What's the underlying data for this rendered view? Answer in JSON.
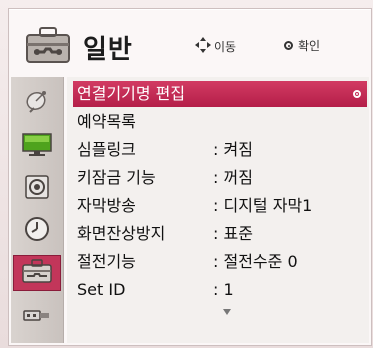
{
  "header": {
    "title": "일반",
    "icon": "toolbox-icon",
    "hint_move": "이동",
    "hint_ok": "확인"
  },
  "sidebar": {
    "items": [
      {
        "icon": "satellite-dish-icon",
        "active": false
      },
      {
        "icon": "monitor-icon",
        "active": false
      },
      {
        "icon": "speaker-icon",
        "active": false
      },
      {
        "icon": "clock-icon",
        "active": false
      },
      {
        "icon": "toolbox-icon",
        "active": true
      },
      {
        "icon": "usb-icon",
        "active": false
      }
    ]
  },
  "menu": {
    "items": [
      {
        "label": "연결기기명 편집",
        "value": "",
        "selected": true
      },
      {
        "label": "예약목록",
        "value": ""
      },
      {
        "label": "심플링크",
        "value": ": 켜짐"
      },
      {
        "label": "키잠금 기능",
        "value": ": 꺼짐"
      },
      {
        "label": "자막방송",
        "value": ": 디지털 자막1"
      },
      {
        "label": "화면잔상방지",
        "value": ": 표준"
      },
      {
        "label": "절전기능",
        "value": ": 절전수준 0"
      },
      {
        "label": "Set ID",
        "value": ": 1"
      }
    ]
  },
  "colors": {
    "accent": "#c2365a",
    "panel_bg": "#f3f0ee",
    "sidebar_bg": "#d2cbc7"
  }
}
